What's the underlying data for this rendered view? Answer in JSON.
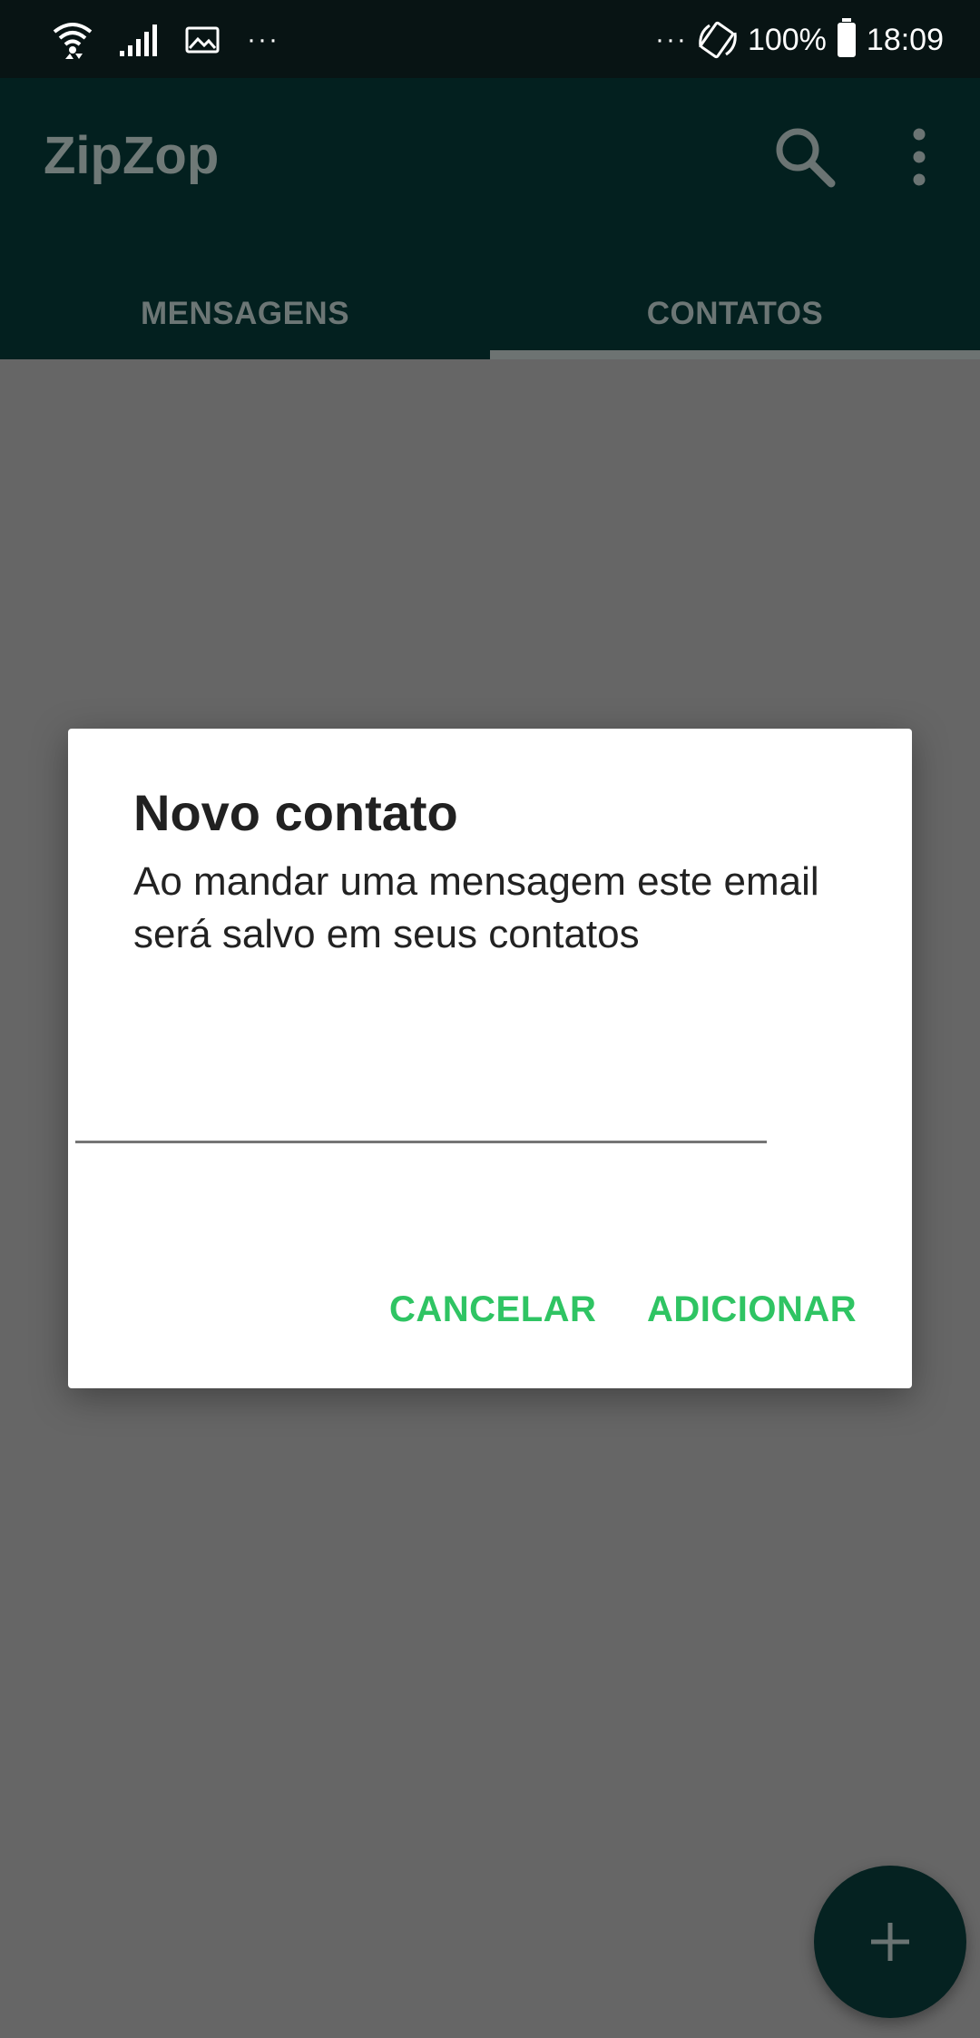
{
  "status_bar": {
    "overflow_left": "···",
    "overflow_right": "···",
    "battery": "100%",
    "time": "18:09",
    "icons": [
      "wifi-icon",
      "signal-icon",
      "gallery-icon",
      "rotate-icon",
      "battery-icon"
    ]
  },
  "app_bar": {
    "title": "ZipZop",
    "icons": [
      "search-icon",
      "more-vert-icon"
    ]
  },
  "tabs": [
    {
      "label": "MENSAGENS",
      "selected": false
    },
    {
      "label": "CONTATOS",
      "selected": true
    }
  ],
  "dialog": {
    "title": "Novo contato",
    "message": "Ao mandar uma mensagem este email será salvo em seus contatos",
    "input": {
      "value": "",
      "placeholder": ""
    },
    "cancel_label": "CANCELAR",
    "add_label": "ADICIONAR"
  },
  "fab": {
    "icon": "plus-icon"
  },
  "colors": {
    "accent": "#2fc463",
    "app_bar": "#03201f",
    "scrim": "#666666"
  }
}
